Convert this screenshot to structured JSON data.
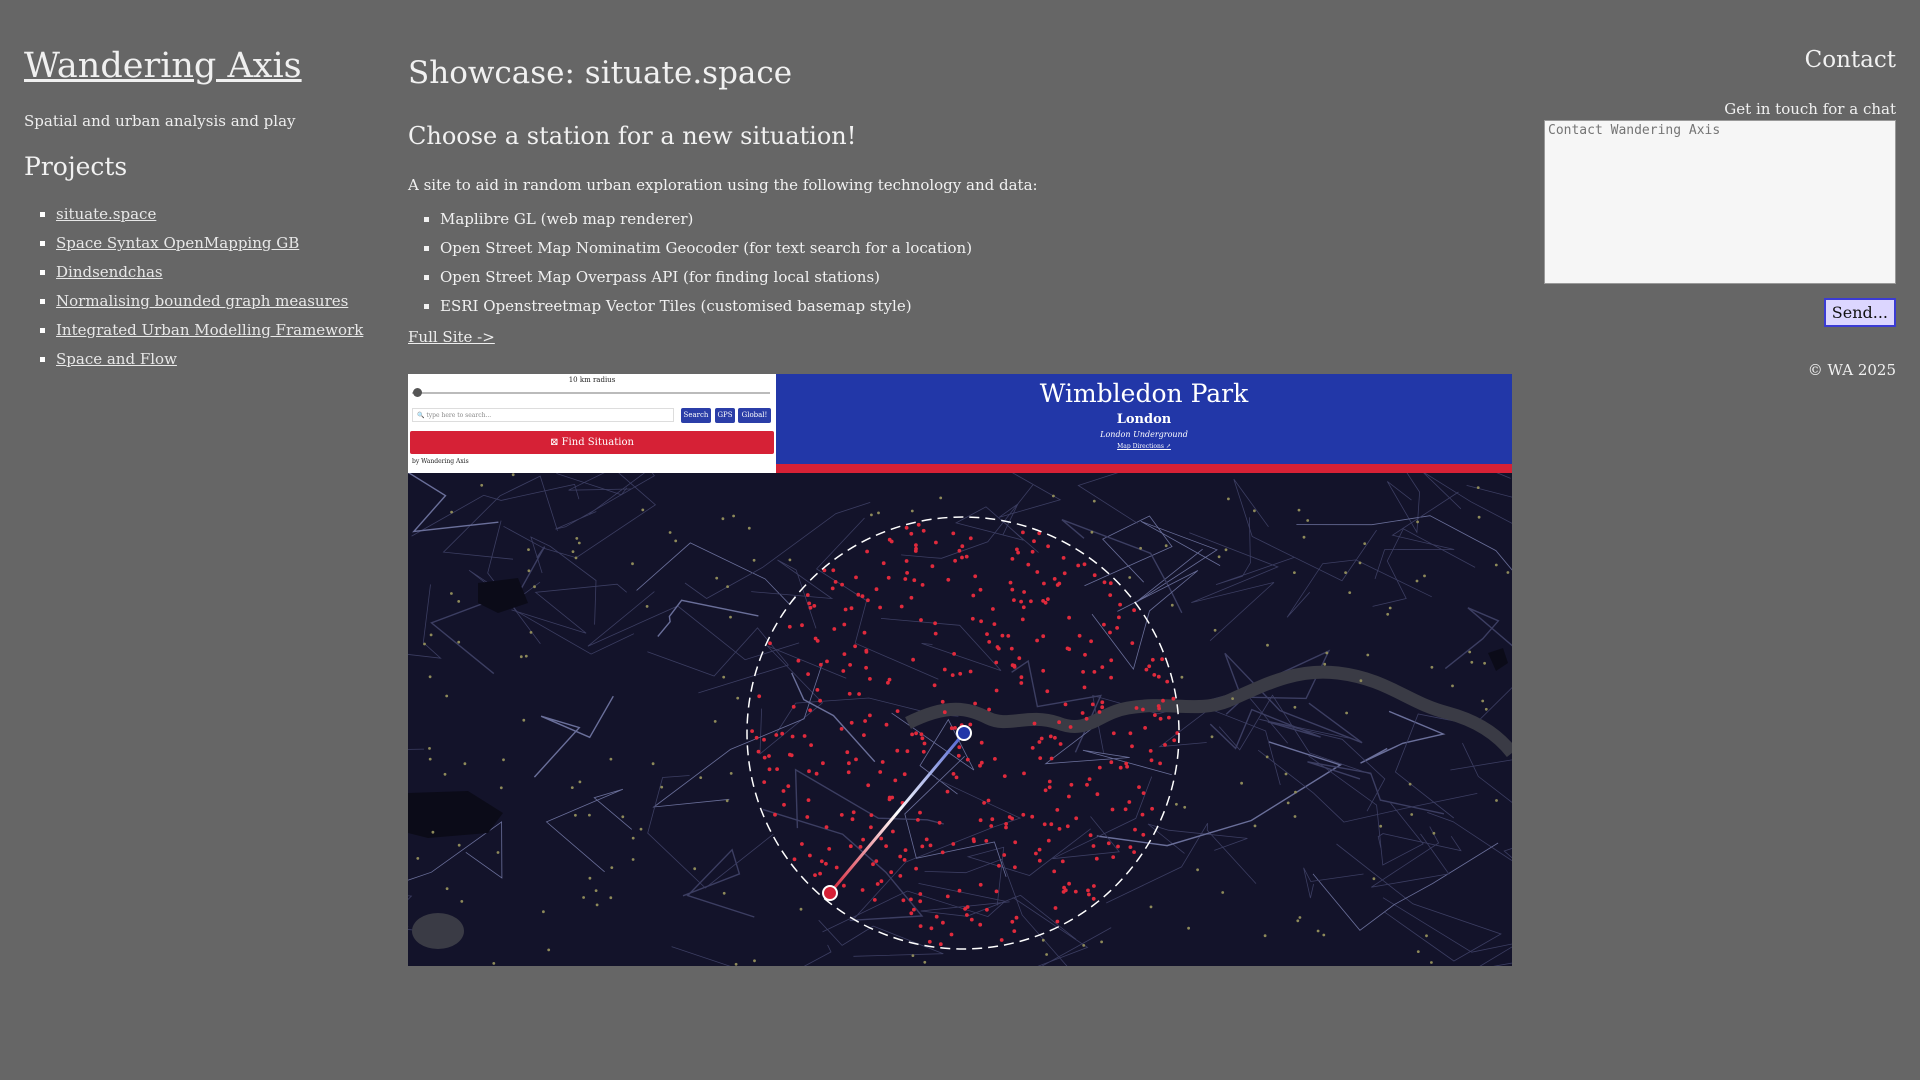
{
  "sidebar": {
    "site_title": "Wandering Axis",
    "tagline": "Spatial and urban analysis and play",
    "projects_heading": "Projects",
    "projects": [
      "situate.space",
      "Space Syntax OpenMapping GB",
      "Dindsendchas",
      "Normalising bounded graph measures",
      "Integrated Urban Modelling Framework",
      "Space and Flow"
    ]
  },
  "main": {
    "title": "Showcase: situate.space",
    "subtitle": "Choose a station for a new situation!",
    "intro": "A site to aid in random urban exploration using the following technology and data:",
    "tech": [
      "Maplibre GL (web map renderer)",
      "Open Street Map Nominatim Geocoder (for text search for a location)",
      "Open Street Map Overpass API (for finding local stations)",
      "ESRI Openstreetmap Vector Tiles (customised basemap style)"
    ],
    "full_site_link": "Full Site ->"
  },
  "screenshot": {
    "radius_label": "10 km radius",
    "search_placeholder": "🔍 type here to search...",
    "search_button": "Search",
    "gps_button": "GPS",
    "global_button": "Global!",
    "find_button": "⊠ Find Situation",
    "by_line": "by  Wandering Axis",
    "station_name": "Wimbledon Park",
    "station_city": "London",
    "station_network": "London Underground",
    "station_directions": "Map Directions ↗",
    "colors": {
      "panel_blue": "#2237a8",
      "accent_red": "#d62136",
      "map_bg": "#13132a"
    }
  },
  "right": {
    "contact_heading": "Contact",
    "contact_prompt": "Get in touch for a chat",
    "contact_placeholder": "Contact Wandering Axis",
    "send_button": "Send...",
    "copyright": "© WA 2025"
  }
}
